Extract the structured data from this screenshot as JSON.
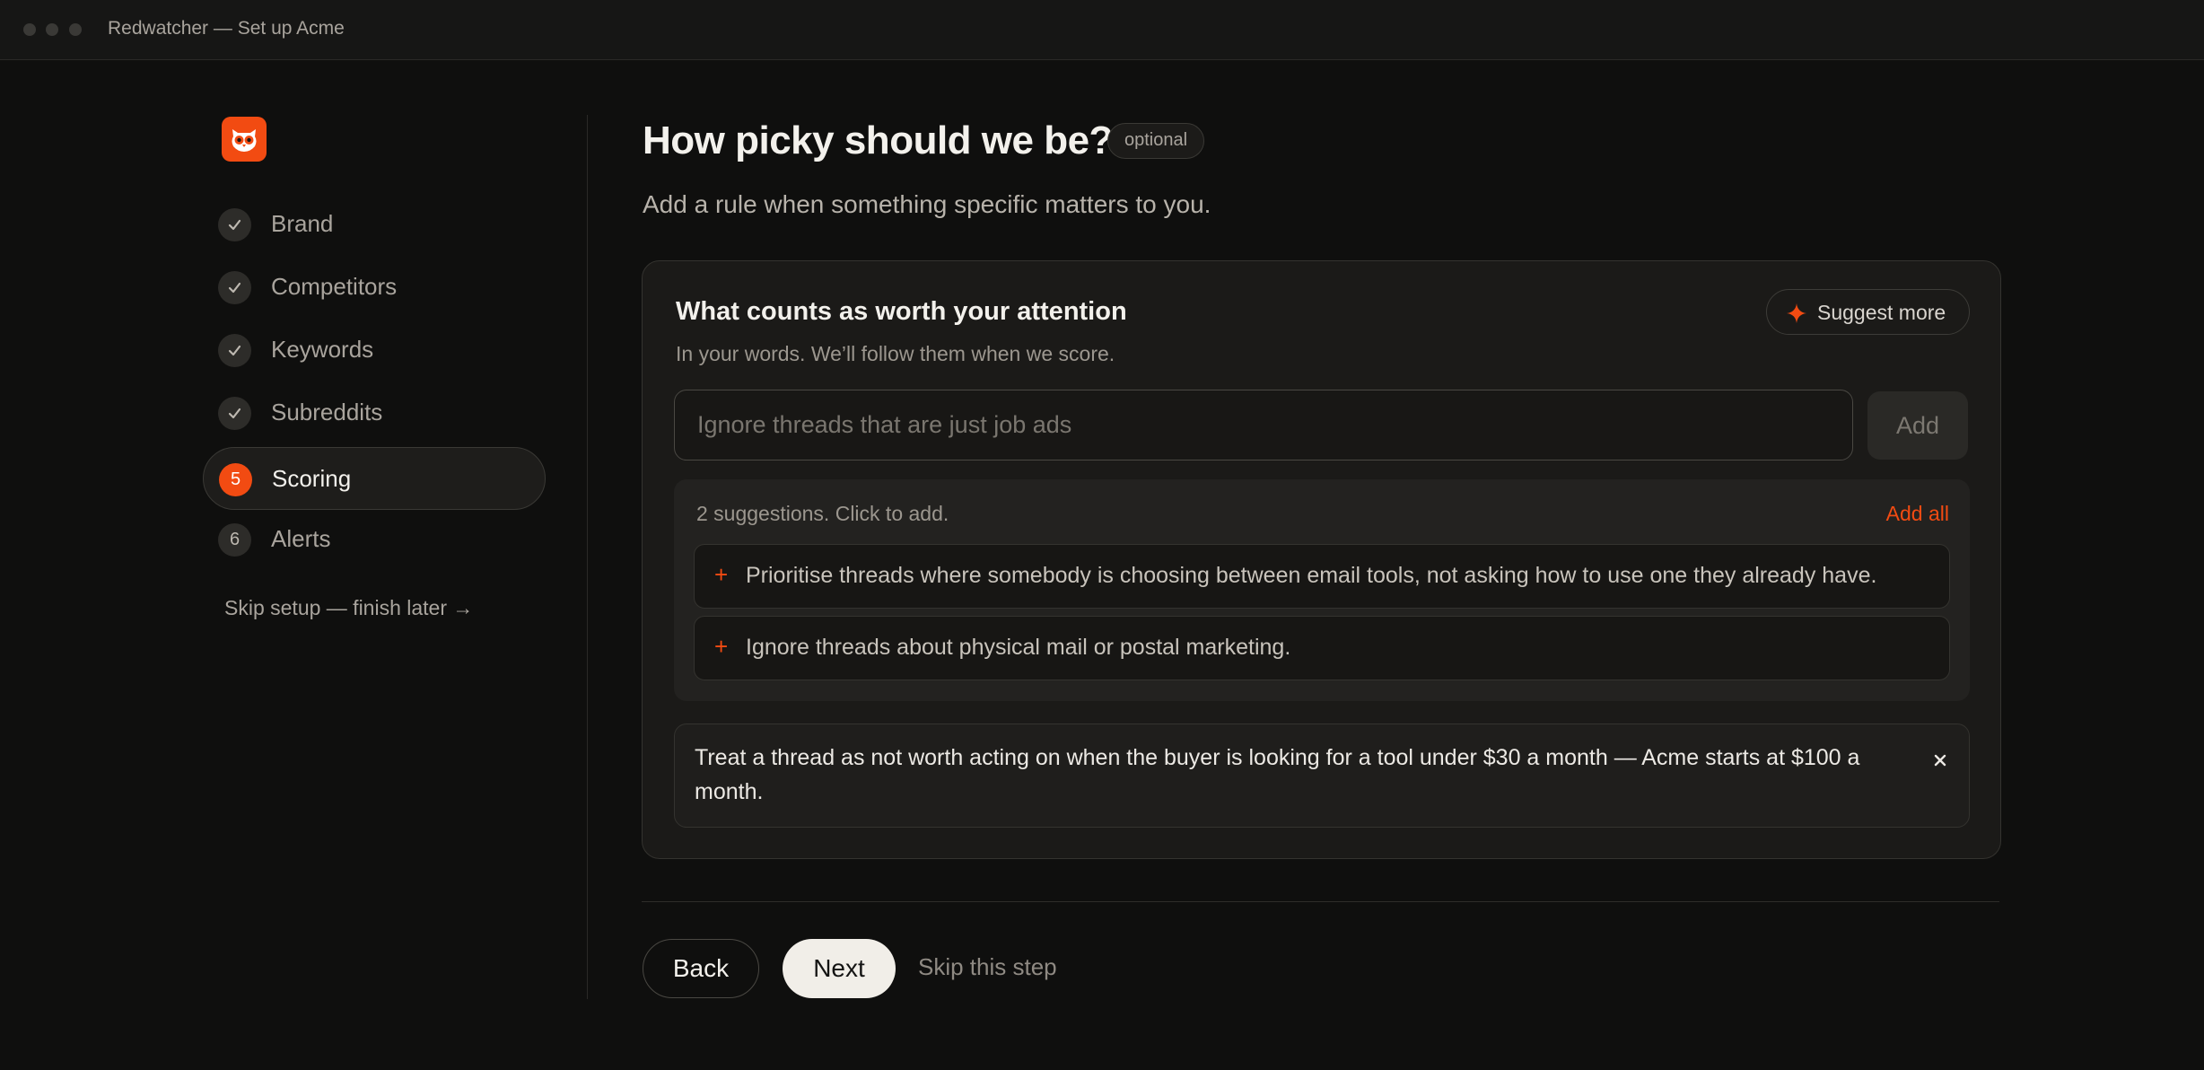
{
  "window": {
    "title": "Redwatcher — Set up Acme"
  },
  "sidebar": {
    "steps": [
      {
        "label": "Brand",
        "state": "done"
      },
      {
        "label": "Competitors",
        "state": "done"
      },
      {
        "label": "Keywords",
        "state": "done"
      },
      {
        "label": "Subreddits",
        "state": "done"
      },
      {
        "label": "Scoring",
        "state": "active",
        "number": "5"
      },
      {
        "label": "Alerts",
        "state": "pending",
        "number": "6"
      }
    ],
    "skip_setup": "Skip setup — finish later →"
  },
  "main": {
    "title": "How picky should we be?",
    "optional_badge": "optional",
    "subtitle": "Add a rule when something specific matters to you."
  },
  "card": {
    "title": "What counts as worth your attention",
    "subtitle": "In your words. We’ll follow them when we score.",
    "suggest_more": "Suggest more",
    "input": {
      "placeholder": "Ignore threads that are just job ads",
      "value": ""
    },
    "add_button": "Add",
    "suggestions": {
      "count_text": "2 suggestions. Click to add.",
      "add_all": "Add all",
      "items": [
        "Prioritise threads where somebody is choosing between email tools, not asking how to use one they already have.",
        "Ignore threads about physical mail or postal marketing."
      ]
    },
    "rules": [
      "Treat a thread as not worth acting on when the buyer is looking for a tool under $30 a month — Acme starts at $100 a month."
    ]
  },
  "footer": {
    "back": "Back",
    "next": "Next",
    "skip_step": "Skip this step"
  },
  "colors": {
    "accent": "#f24b12",
    "background": "#0f0f0e",
    "card": "#1b1a18"
  },
  "icons": {
    "logo": "owl-logo-icon",
    "done": "check-icon",
    "suggest": "sparkle-icon",
    "suggestion_add": "plus-icon",
    "remove_rule": "close-icon"
  }
}
